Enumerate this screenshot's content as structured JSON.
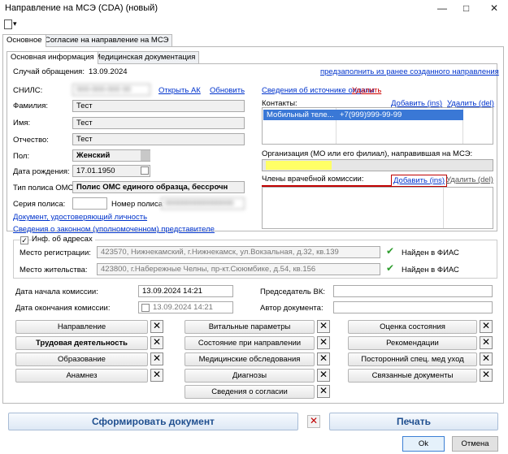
{
  "window": {
    "title": "Направление на МСЭ (CDA) (новый)",
    "minimize": "—",
    "maximize": "□",
    "close": "✕"
  },
  "toolbar": {
    "icon": "document-icon",
    "dropdown": "▾"
  },
  "tabs_top": [
    "Основное",
    "Согласие на направление на МСЭ"
  ],
  "tabs_inner": [
    "Основная информация",
    "Медицинская документация"
  ],
  "case": {
    "label": "Случай обращения:",
    "value": "13.09.2024",
    "prefill_link": "предзаполнить из ранее созданного направления"
  },
  "snils": {
    "label": "СНИЛС:",
    "value": "000-000-000 00",
    "open_ak": "Открыть АК",
    "refresh": "Обновить"
  },
  "surname": {
    "label": "Фамилия:",
    "value": "Тест"
  },
  "name": {
    "label": "Имя:",
    "value": "Тест"
  },
  "patronymic": {
    "label": "Отчество:",
    "value": "Тест"
  },
  "sex": {
    "label": "Пол:",
    "value": "Женский"
  },
  "birth": {
    "label": "Дата рождения:",
    "value": "17.01.1950"
  },
  "policy_type": {
    "label": "Тип полиса ОМС:",
    "value": "Полис ОМС единого образца, бессрочн"
  },
  "policy_series": {
    "label": "Серия полиса:",
    "value": ""
  },
  "policy_number": {
    "label": "Номер полиса:",
    "value": "0000000000000000"
  },
  "doc_link": "Документ, удостоверяющий личность",
  "rep_link": "Сведения о законном (уполномоченном) представителе",
  "payment": {
    "link": "Сведения об источнике оплаты",
    "delete": "Удалить"
  },
  "contacts": {
    "label": "Контакты:",
    "add": "Добавить (ins)",
    "delete": "Удалить (del)",
    "rows": [
      {
        "type": "Мобильный теле...",
        "value": "+7(999)999-99-99"
      }
    ]
  },
  "org": {
    "label": "Организация (МО или его филиал), направившая на МСЭ:",
    "value": "ГАУЗ ..."
  },
  "commission": {
    "label": "Члены врачебной комиссии:",
    "add": "Добавить (ins)",
    "delete": "Удалить (del)"
  },
  "address": {
    "checkbox": "Инф. об адресах",
    "checked": "✓",
    "reg_label": "Место регистрации:",
    "reg_value": "423570, Нижнекамский, г.Нижнекамск, ул.Вокзальная, д.32, кв.139",
    "live_label": "Место жительства:",
    "live_value": "423800, г.Набережные Челны, пр-кт.Сююмбике, д.54, кв.156",
    "fias": "Найден в ФИАС"
  },
  "commission_start": {
    "label": "Дата начала комиссии:",
    "value": "13.09.2024 14:21"
  },
  "commission_end": {
    "label": "Дата окончания комиссии:",
    "value": "13.09.2024 14:21"
  },
  "chairman": {
    "label": "Председатель ВК:",
    "value": ""
  },
  "author": {
    "label": "Автор документа:",
    "value": ""
  },
  "sections": {
    "col1": [
      "Направление",
      "Трудовая деятельность",
      "Образование",
      "Анамнез"
    ],
    "col2": [
      "Витальные параметры",
      "Состояние при направлении",
      "Медицинские обследования",
      "Диагнозы",
      "Сведения о согласии"
    ],
    "col3": [
      "Оценка состояния",
      "Рекомендации",
      "Посторонний спец. мед уход",
      "Связанные документы"
    ]
  },
  "close_glyph": "✕",
  "bottom": {
    "form": "Сформировать документ",
    "print": "Печать",
    "ok": "Ok",
    "cancel": "Отмена"
  },
  "colors": {
    "highlight": "#ffff66",
    "accent_red": "#c00000",
    "link": "#0033cc"
  }
}
